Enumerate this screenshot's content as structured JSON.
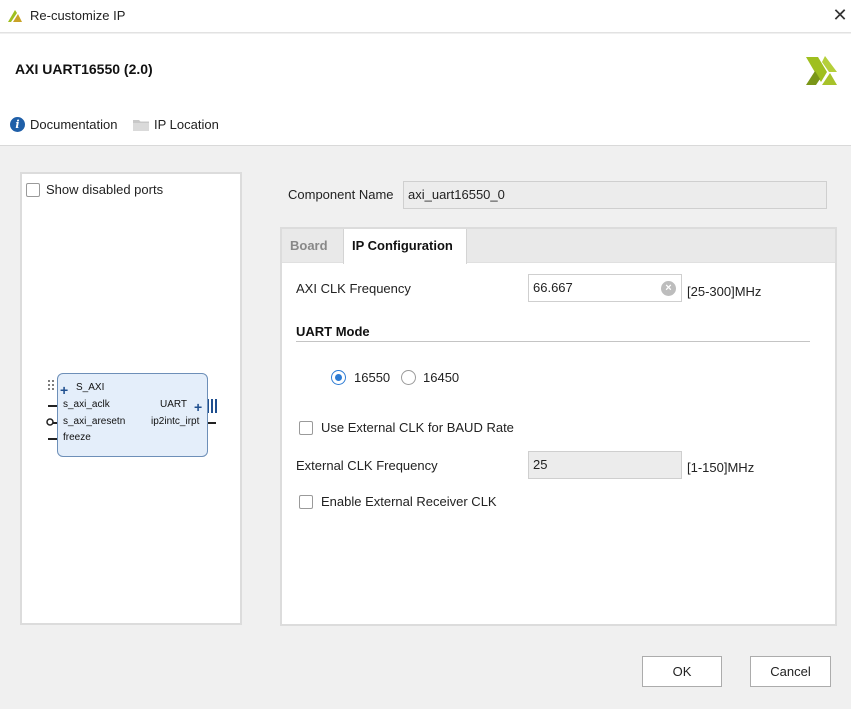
{
  "window": {
    "title": "Re-customize IP",
    "close_glyph": "✕",
    "logo_icon": "vivado-logo-icon"
  },
  "header": {
    "ip_title": "AXI UART16550 (2.0)",
    "brand_icon": "xilinx-logo-icon",
    "brand_color": "#9fbf1f",
    "links": {
      "documentation": "Documentation",
      "ip_location": "IP Location"
    }
  },
  "left_panel": {
    "show_disabled_ports": "Show disabled ports",
    "show_disabled_checked": false,
    "block": {
      "inputs": [
        "S_AXI",
        "s_axi_aclk",
        "s_axi_aresetn",
        "freeze"
      ],
      "outputs": [
        "UART",
        "ip2intc_irpt"
      ]
    }
  },
  "component": {
    "label": "Component Name",
    "value": "axi_uart16550_0"
  },
  "tabs": {
    "board": "Board",
    "ip_configuration": "IP Configuration",
    "active": "IP Configuration"
  },
  "config": {
    "axi_clk": {
      "label": "AXI CLK Frequency",
      "value": "66.667",
      "range": "[25-300]MHz"
    },
    "uart_mode": {
      "title": "UART Mode",
      "options": [
        "16550",
        "16450"
      ],
      "selected": "16550"
    },
    "use_ext_clk": {
      "label": "Use External CLK for BAUD Rate",
      "checked": false
    },
    "ext_clk_freq": {
      "label": "External CLK Frequency",
      "value": "25",
      "range": "[1-150]MHz"
    },
    "enable_ext_rx_clk": {
      "label": "Enable External Receiver CLK",
      "checked": false
    }
  },
  "buttons": {
    "ok": "OK",
    "cancel": "Cancel"
  },
  "colors": {
    "accent": "#2c7bd4",
    "block_fill": "#e4eefa",
    "block_border": "#6d8fb8"
  }
}
